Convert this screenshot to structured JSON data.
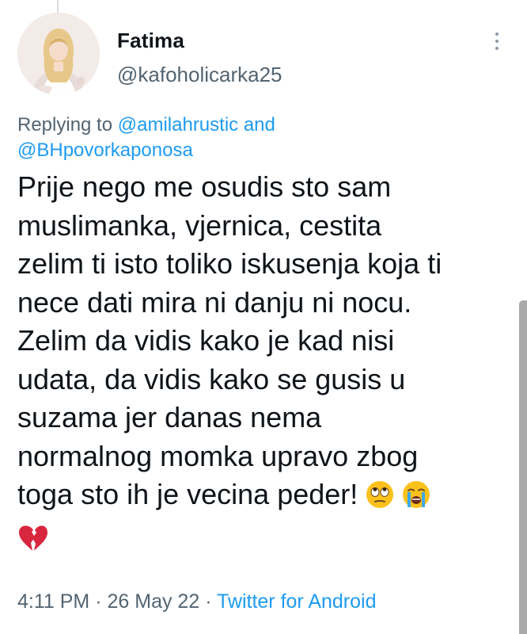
{
  "tweet": {
    "author_name": "Fatima",
    "author_handle": "@kafoholicarka25",
    "replying_prefix": "Replying to",
    "reply_mention_1": "@amilahrustic",
    "reply_conjunction": "and",
    "reply_mention_2": "@BHpovorkaponosa",
    "text_lines": [
      "Prije nego me osudis sto sam",
      "muslimanka, vjernica, cestita",
      "zelim ti isto toliko iskusenja koja ti",
      "nece dati mira ni danju ni nocu.",
      "Zelim da vidis kako je kad nisi",
      "udata, da vidis kako se gusis u",
      "suzama jer danas nema",
      "normalnog momka upravo zbog",
      "toga sto ih je vecina peder!"
    ],
    "emojis": [
      "face-with-rolling-eyes-emoji",
      "loudly-crying-face-emoji",
      "broken-heart-emoji"
    ],
    "time": "4:11 PM",
    "separator": "·",
    "date": "26 May 22",
    "source": "Twitter for Android"
  },
  "colors": {
    "text_primary": "#0f1419",
    "text_secondary": "#536471",
    "link": "#1d9bf0"
  }
}
